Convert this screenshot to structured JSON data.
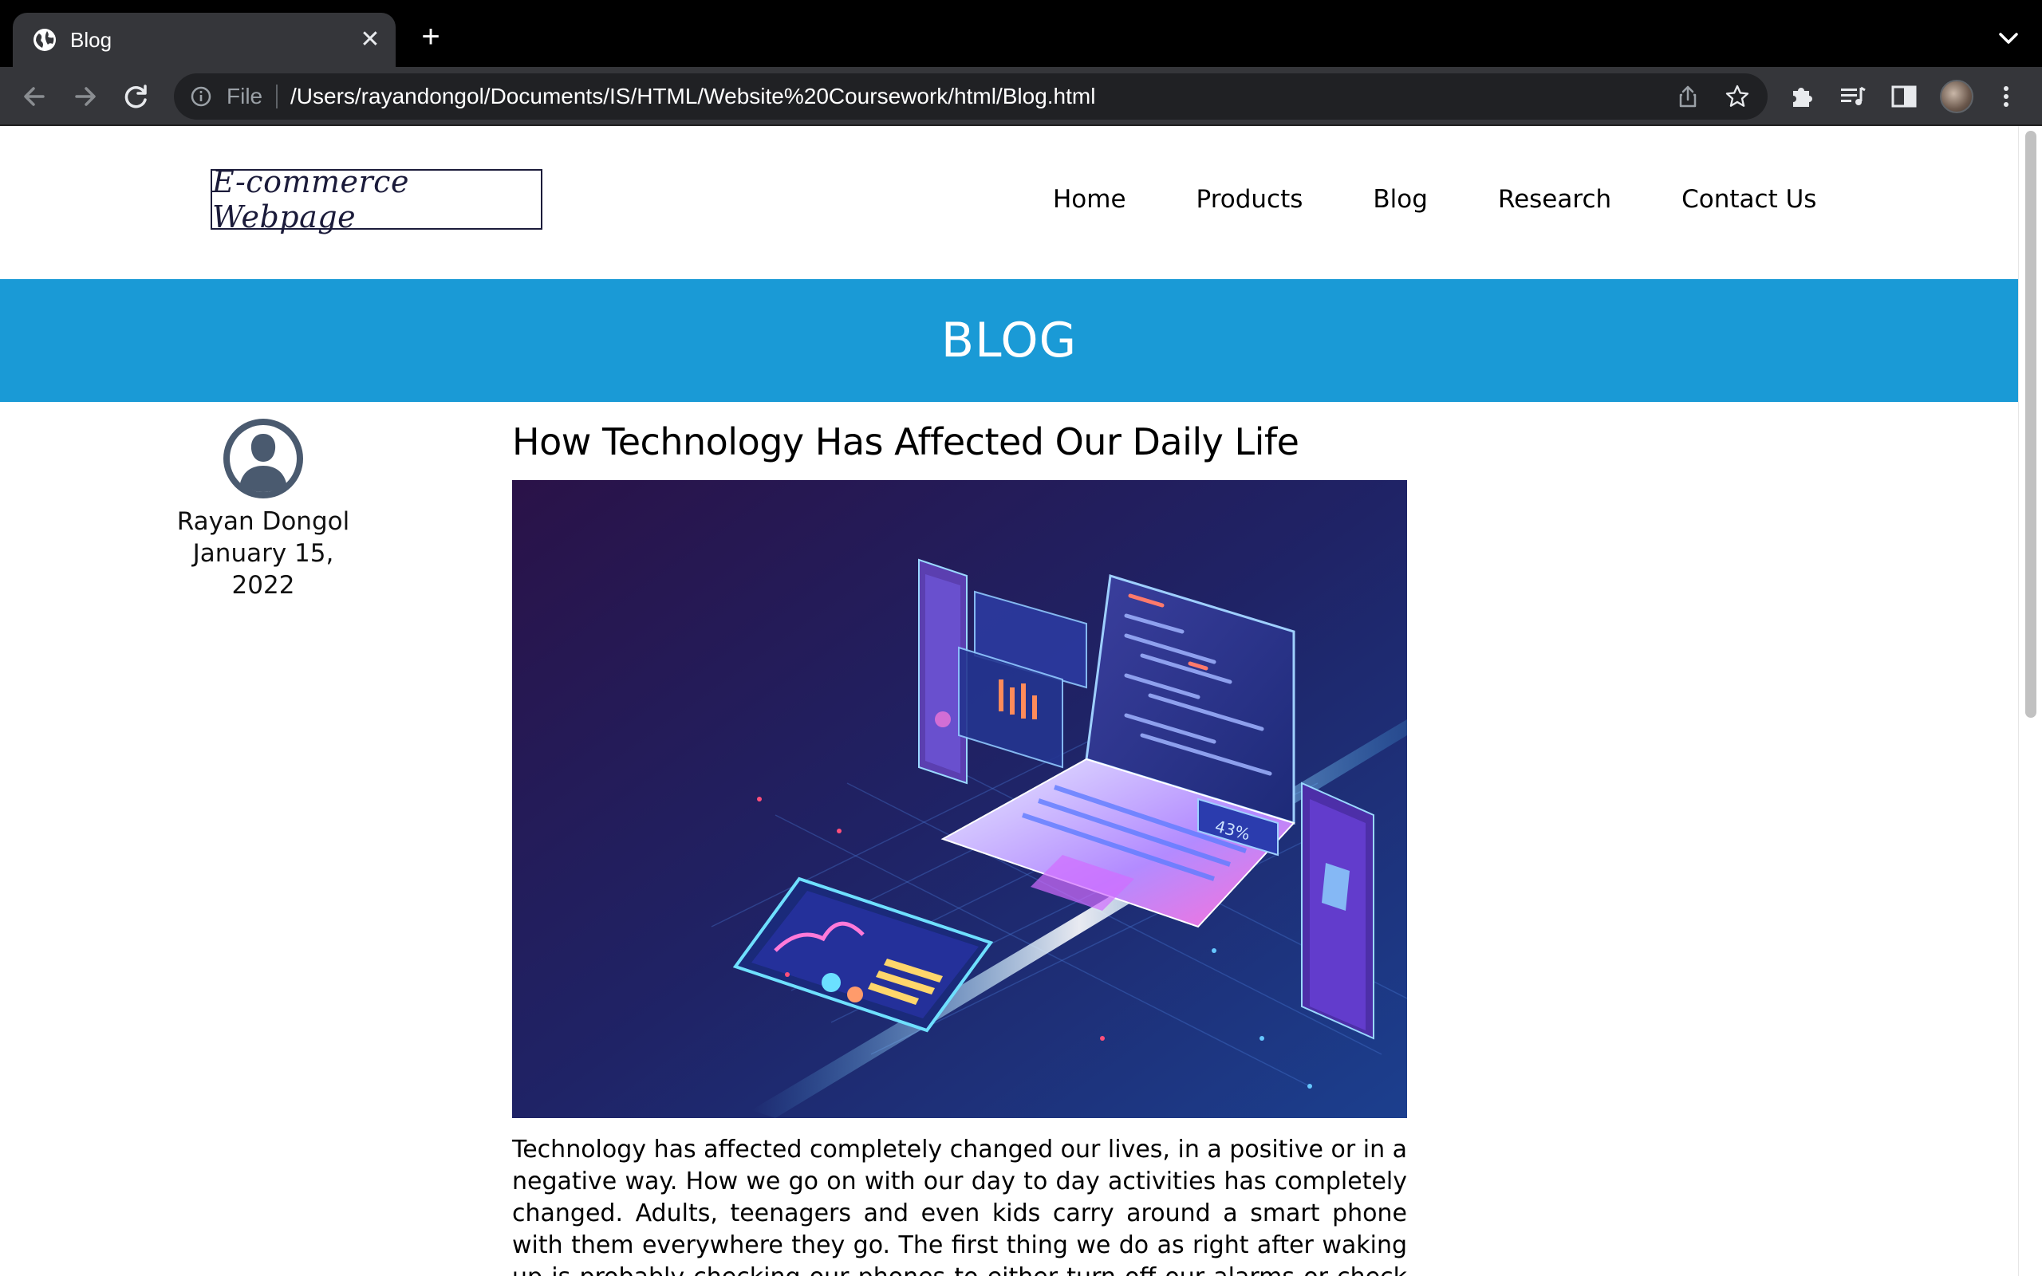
{
  "browser": {
    "tab_title": "Blog",
    "scheme_label": "File",
    "url": "/Users/rayandongol/Documents/IS/HTML/Website%20Coursework/html/Blog.html"
  },
  "site": {
    "logo_text": "E-commerce Webpage",
    "nav": [
      "Home",
      "Products",
      "Blog",
      "Research",
      "Contact Us"
    ],
    "banner_title": "BLOG"
  },
  "author": {
    "name": "Rayan Dongol",
    "date": "January 15, 2022"
  },
  "article": {
    "title": "How Technology Has Affected Our Daily Life",
    "hero_image_percent_label": "43%",
    "body": "Technology has affected completely changed our lives, in a positive or in a negative way. How we go on with our day to day activities has completely changed. Adults, teenagers and even kids carry around a smart phone with them everywhere they go. The first thing we do as right after waking up is probably checking our phones to either turn off our alarms or check our social media"
  },
  "colors": {
    "banner": "#1a9ad6",
    "chrome_dark": "#35363a",
    "omnibox": "#202124"
  }
}
